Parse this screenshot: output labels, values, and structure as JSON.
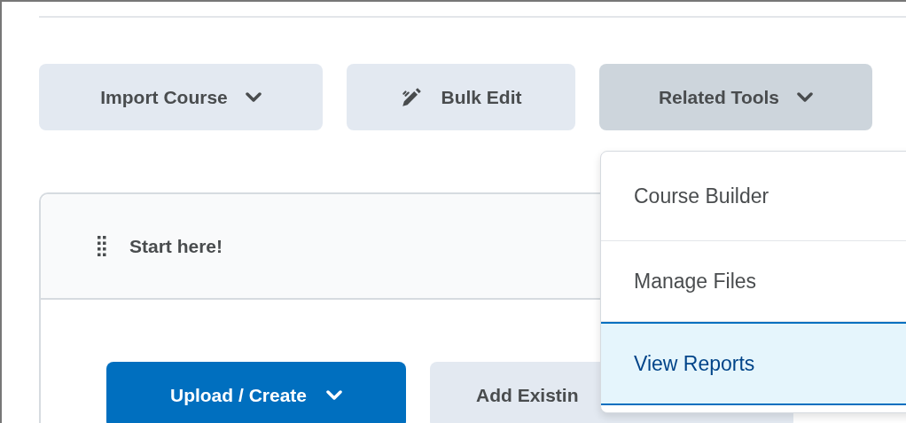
{
  "toolbar": [
    {
      "label": "Import Course",
      "kind": "dropdown",
      "expanded": false
    },
    {
      "label": "Bulk Edit",
      "kind": "edit",
      "expanded": false
    },
    {
      "label": "Related Tools",
      "kind": "dropdown",
      "expanded": true
    }
  ],
  "menu": [
    {
      "label": "Course Builder",
      "selected": false
    },
    {
      "label": "Manage Files",
      "selected": false
    },
    {
      "label": "View Reports",
      "selected": true
    }
  ],
  "module": {
    "title": "Start here!",
    "actions": [
      {
        "label": "Upload / Create",
        "kind": "primary"
      },
      {
        "label": "Add Existin",
        "kind": "secondary"
      }
    ]
  }
}
